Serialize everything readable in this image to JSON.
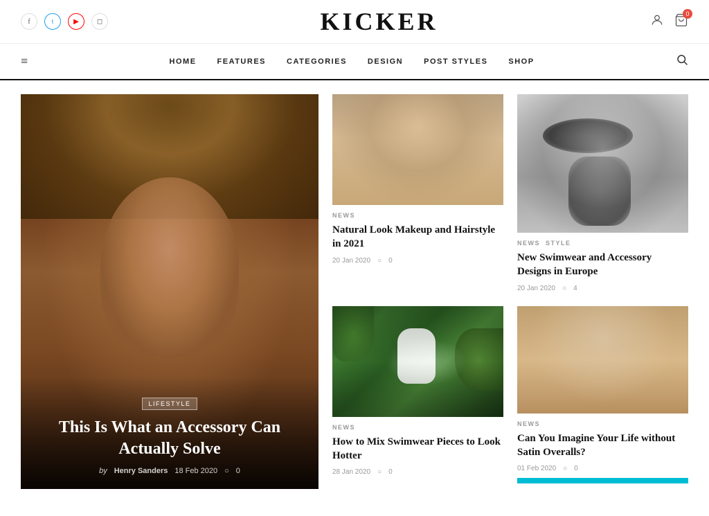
{
  "site": {
    "title": "KICKER"
  },
  "social": {
    "facebook_label": "f",
    "twitter_label": "t",
    "youtube_label": "▶",
    "instagram_label": "◻"
  },
  "cart": {
    "badge": "0"
  },
  "nav": {
    "hamburger": "≡",
    "search_icon": "⌕",
    "links": [
      {
        "label": "HOME",
        "id": "home"
      },
      {
        "label": "FEATURES",
        "id": "features"
      },
      {
        "label": "CATEGORIES",
        "id": "categories"
      },
      {
        "label": "DESIGN",
        "id": "design"
      },
      {
        "label": "POST STYLES",
        "id": "post-styles"
      },
      {
        "label": "SHOP",
        "id": "shop"
      }
    ]
  },
  "featured": {
    "tag": "LIFESTYLE",
    "title": "This Is What an Accessory Can Actually Solve",
    "by": "by",
    "author": "Henry Sanders",
    "date": "18 Feb 2020",
    "comment_icon": "○",
    "comment_count": "0"
  },
  "articles": [
    {
      "id": "article-1",
      "tags": [
        "NEWS"
      ],
      "title": "Natural Look Makeup and Hairstyle in 2021",
      "date": "20 Jan 2020",
      "comment_icon": "○",
      "comment_count": "0",
      "img_type": "blonde-woman"
    },
    {
      "id": "article-2",
      "tags": [
        "NEWS",
        "STYLE"
      ],
      "title": "New Swimwear and Accessory Designs in Europe",
      "date": "20 Jan 2020",
      "comment_icon": "○",
      "comment_count": "4",
      "img_type": "hat-woman"
    },
    {
      "id": "article-3",
      "tags": [
        "NEWS"
      ],
      "title": "How to Mix Swimwear Pieces to Look Hotter",
      "date": "28 Jan 2020",
      "comment_icon": "○",
      "comment_count": "0",
      "img_type": "jungle-woman"
    },
    {
      "id": "article-4",
      "tags": [
        "NEWS"
      ],
      "title": "Can You Imagine Your Life without Satin Overalls?",
      "date": "01 Feb 2020",
      "comment_icon": "○",
      "comment_count": "0",
      "img_type": "satin-woman"
    }
  ],
  "bottom_bar": {
    "color": "#00bcd4"
  }
}
